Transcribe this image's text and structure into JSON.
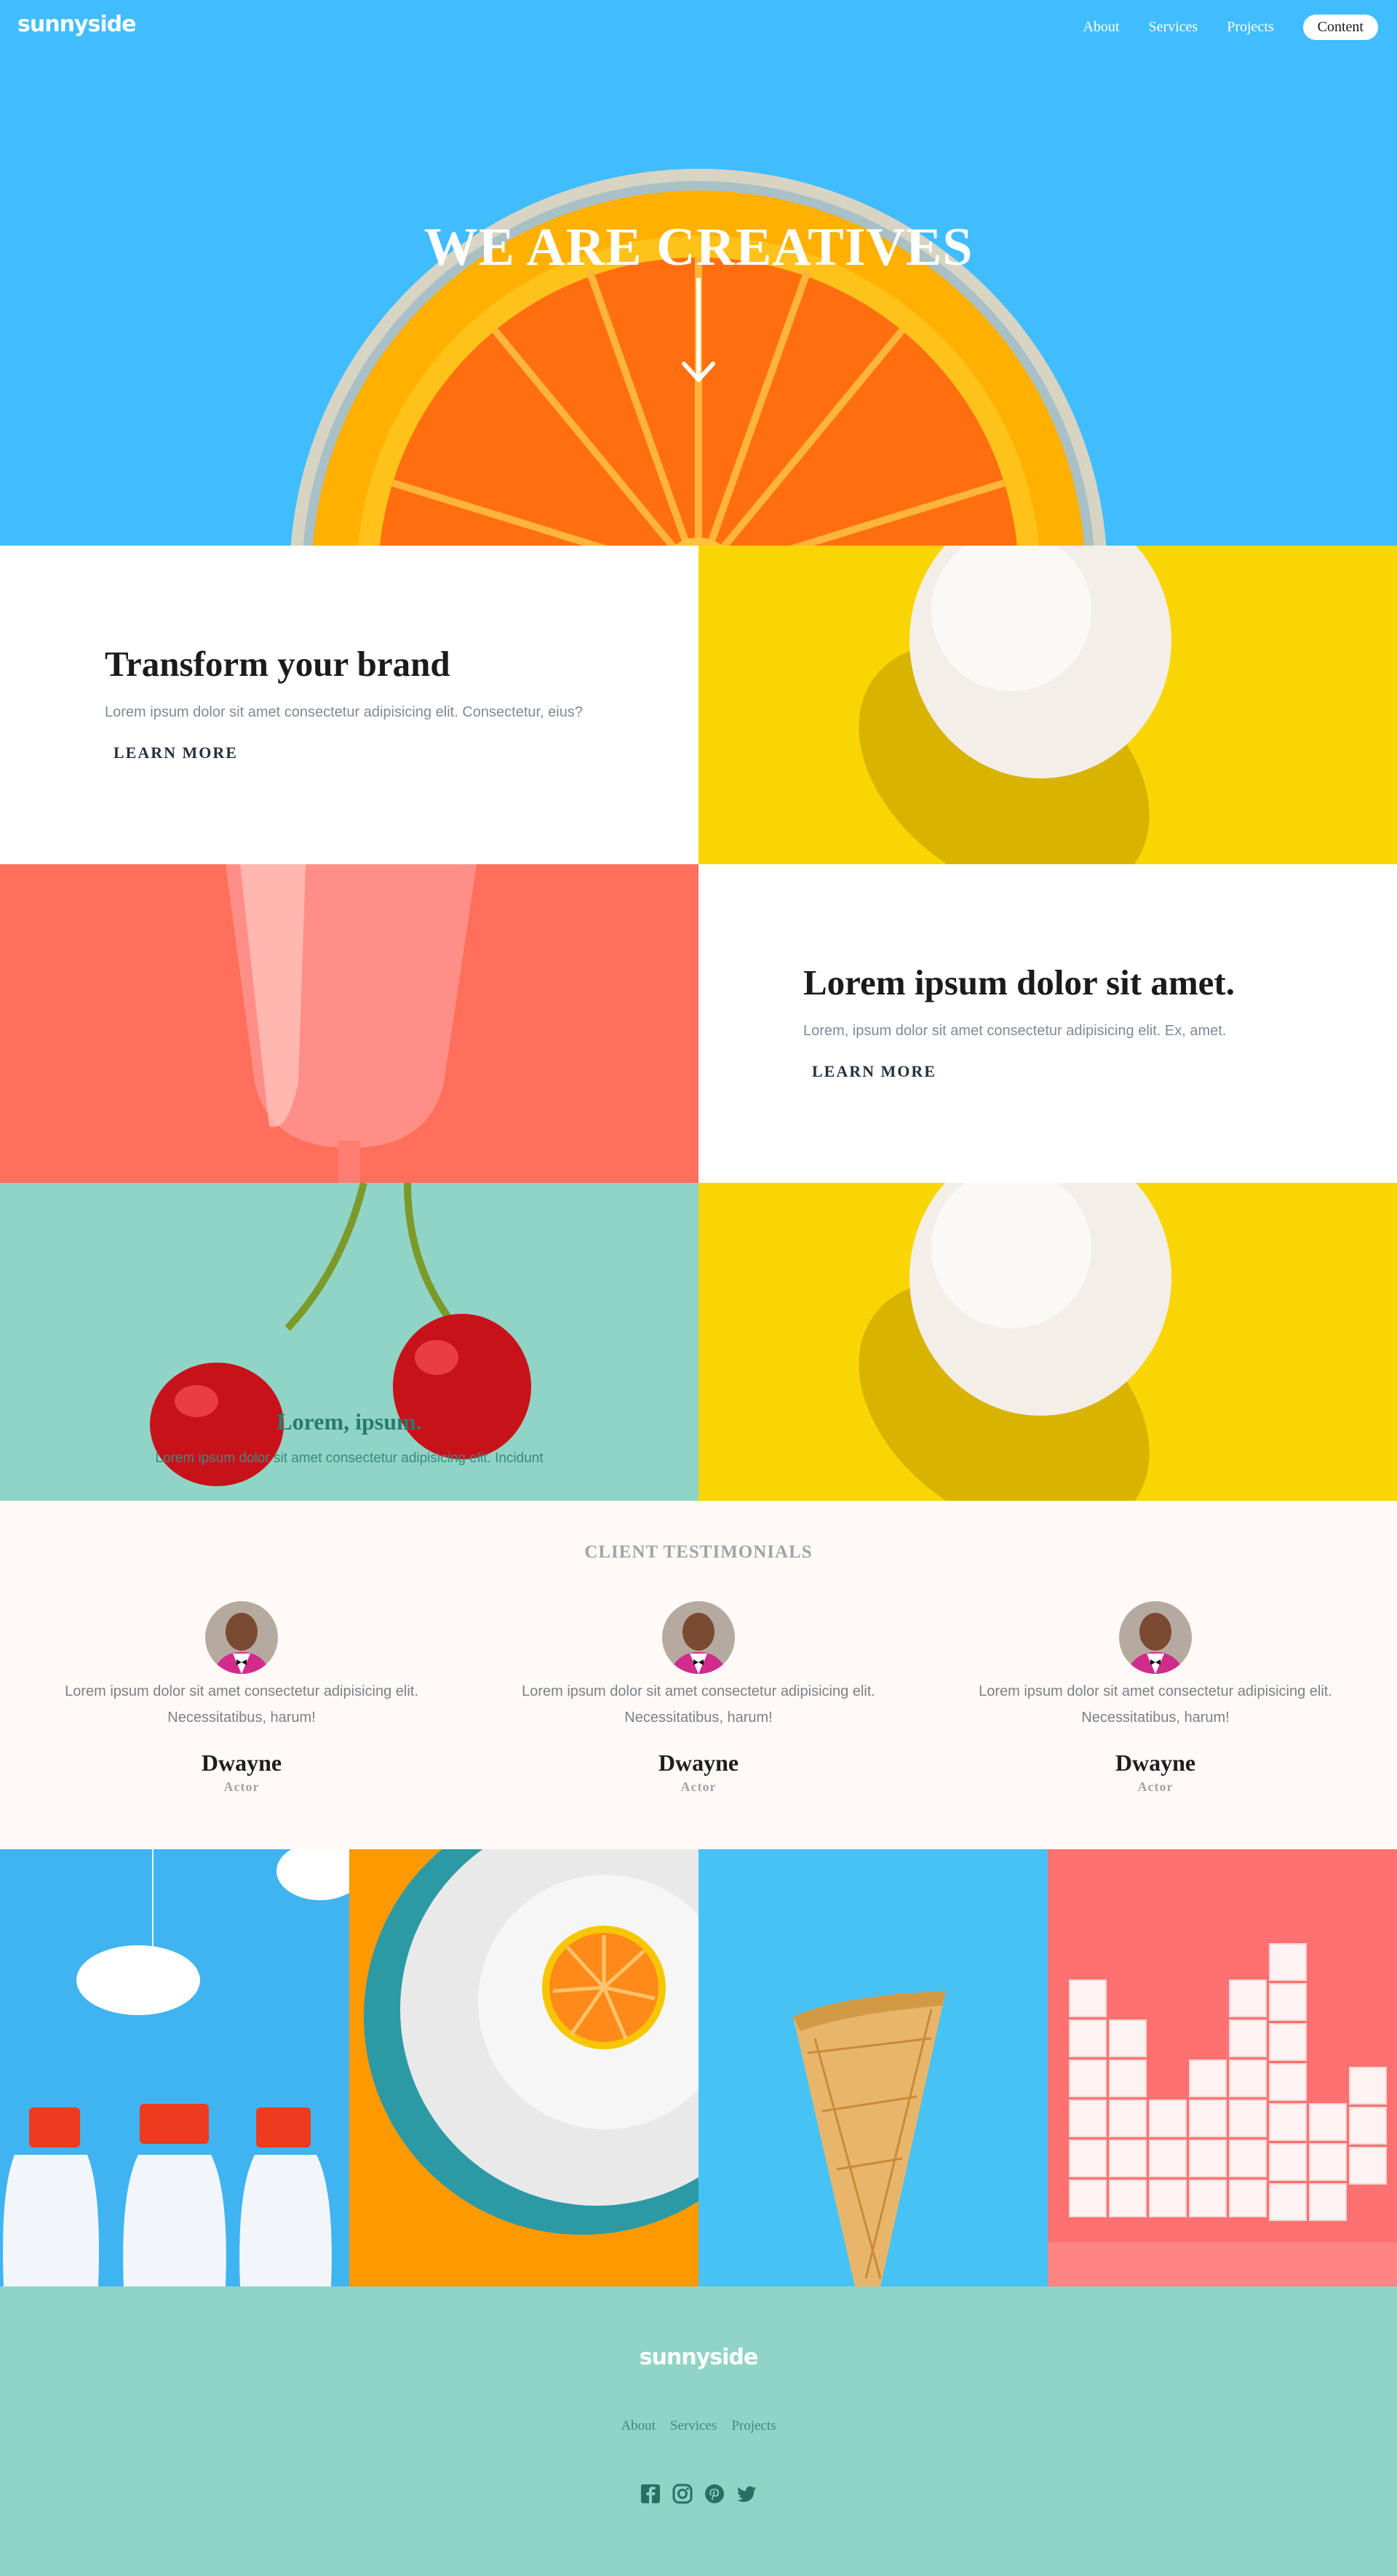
{
  "header": {
    "logo": "sunnyside",
    "nav": [
      "About",
      "Services",
      "Projects"
    ],
    "cta": "Content"
  },
  "hero": {
    "title": "WE ARE CREATIVES",
    "arrow_icon": "arrow-down-icon"
  },
  "features": {
    "brand": {
      "title": "Transform your brand",
      "text": "Lorem ipsum dolor sit amet consectetur adipisicing elit. Consectetur, eius?",
      "link": "LEARN MORE"
    },
    "lorem": {
      "title": "Lorem ipsum dolor sit amet.",
      "text": "Lorem, ipsum dolor sit amet consectetur adipisicing elit. Ex, amet.",
      "link": "LEARN MORE"
    },
    "cherry_caption": {
      "title": "Lorem, ipsum.",
      "text": "Lorem ipsum dolor sit amet consectetur adipisicing elit. Incidunt"
    }
  },
  "testimonials": {
    "heading": "CLIENT TESTIMONIALS",
    "items": [
      {
        "quote_line1": "Lorem ipsum dolor sit amet consectetur adipisicing elit.",
        "quote_line2": "Necessitatibus, harum!",
        "name": "Dwayne",
        "role": "Actor"
      },
      {
        "quote_line1": "Lorem ipsum dolor sit amet consectetur adipisicing elit.",
        "quote_line2": "Necessitatibus, harum!",
        "name": "Dwayne",
        "role": "Actor"
      },
      {
        "quote_line1": "Lorem ipsum dolor sit amet consectetur adipisicing elit.",
        "quote_line2": "Necessitatibus, harum!",
        "name": "Dwayne",
        "role": "Actor"
      }
    ]
  },
  "footer": {
    "logo": "sunnyside",
    "links": [
      "About",
      "Services",
      "Projects"
    ],
    "socials": [
      "facebook-icon",
      "instagram-icon",
      "pinterest-icon",
      "twitter-icon"
    ]
  },
  "colors": {
    "hero_blue": "#40bdff",
    "yellow": "#f9d603",
    "coral": "#ff6f5b",
    "teal": "#90d4c5",
    "orange": "#ff9900",
    "cream": "#fffaf7"
  }
}
